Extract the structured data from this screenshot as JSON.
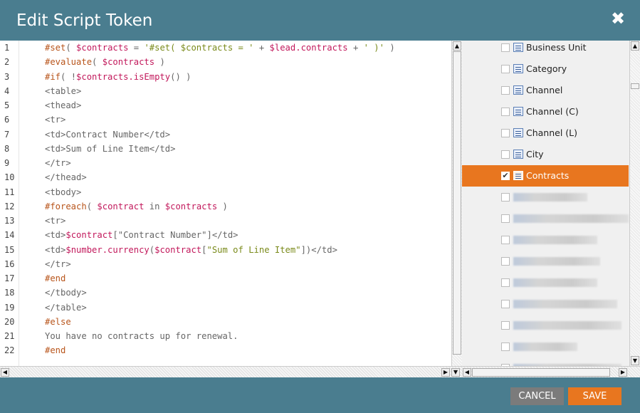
{
  "dialog": {
    "title": "Edit Script Token"
  },
  "editor": {
    "line_numbers": [
      "1",
      "2",
      "3",
      "4",
      "5",
      "6",
      "7",
      "8",
      "9",
      "10",
      "11",
      "12",
      "13",
      "14",
      "15",
      "16",
      "17",
      "18",
      "19",
      "20",
      "21",
      "22"
    ],
    "lines": [
      [
        {
          "t": "#set",
          "c": "dir"
        },
        {
          "t": "( ",
          "c": "plain"
        },
        {
          "t": "$contracts",
          "c": "var"
        },
        {
          "t": " = ",
          "c": "plain"
        },
        {
          "t": "'#set( $contracts = '",
          "c": "str"
        },
        {
          "t": " + ",
          "c": "plain"
        },
        {
          "t": "$lead.contracts",
          "c": "var"
        },
        {
          "t": " + ",
          "c": "plain"
        },
        {
          "t": "' )'",
          "c": "str"
        },
        {
          "t": " )",
          "c": "plain"
        }
      ],
      [
        {
          "t": "#evaluate",
          "c": "dir"
        },
        {
          "t": "( ",
          "c": "plain"
        },
        {
          "t": "$contracts",
          "c": "var"
        },
        {
          "t": " )",
          "c": "plain"
        }
      ],
      [
        {
          "t": "#if",
          "c": "dir"
        },
        {
          "t": "( !",
          "c": "plain"
        },
        {
          "t": "$contracts.isEmpty",
          "c": "var"
        },
        {
          "t": "() )",
          "c": "plain"
        }
      ],
      [
        {
          "t": "<table>",
          "c": "plain"
        }
      ],
      [
        {
          "t": "<thead>",
          "c": "plain"
        }
      ],
      [
        {
          "t": "<tr>",
          "c": "plain"
        }
      ],
      [
        {
          "t": "<td>Contract Number</td>",
          "c": "plain"
        }
      ],
      [
        {
          "t": "<td>Sum of Line Item</td>",
          "c": "plain"
        }
      ],
      [
        {
          "t": "</tr>",
          "c": "plain"
        }
      ],
      [
        {
          "t": "</thead>",
          "c": "plain"
        }
      ],
      [
        {
          "t": "<tbody>",
          "c": "plain"
        }
      ],
      [
        {
          "t": "#foreach",
          "c": "dir"
        },
        {
          "t": "( ",
          "c": "plain"
        },
        {
          "t": "$contract",
          "c": "var"
        },
        {
          "t": " in ",
          "c": "plain"
        },
        {
          "t": "$contracts",
          "c": "var"
        },
        {
          "t": " )",
          "c": "plain"
        }
      ],
      [
        {
          "t": "<tr>",
          "c": "plain"
        }
      ],
      [
        {
          "t": "<td>",
          "c": "plain"
        },
        {
          "t": "$contract",
          "c": "var"
        },
        {
          "t": "[\"Contract Number\"]</td>",
          "c": "plain"
        }
      ],
      [
        {
          "t": "<td>",
          "c": "plain"
        },
        {
          "t": "$number.currency",
          "c": "var"
        },
        {
          "t": "(",
          "c": "plain"
        },
        {
          "t": "$contract",
          "c": "var"
        },
        {
          "t": "[",
          "c": "plain"
        },
        {
          "t": "\"Sum of Line Item\"",
          "c": "str"
        },
        {
          "t": "])</td>",
          "c": "plain"
        }
      ],
      [
        {
          "t": "</tr>",
          "c": "plain"
        }
      ],
      [
        {
          "t": "#end",
          "c": "dir"
        }
      ],
      [
        {
          "t": "</tbody>",
          "c": "plain"
        }
      ],
      [
        {
          "t": "</table>",
          "c": "plain"
        }
      ],
      [
        {
          "t": "#else",
          "c": "dir"
        }
      ],
      [
        {
          "t": "You have no contracts up for renewal.",
          "c": "plain"
        }
      ],
      [
        {
          "t": "#end",
          "c": "dir"
        }
      ]
    ]
  },
  "field_list": {
    "items": [
      {
        "label": "Business Unit",
        "checked": false
      },
      {
        "label": "Category",
        "checked": false
      },
      {
        "label": "Channel",
        "checked": false
      },
      {
        "label": "Channel (C)",
        "checked": false
      },
      {
        "label": "Channel (L)",
        "checked": false
      },
      {
        "label": "City",
        "checked": false
      },
      {
        "label": "Contracts",
        "checked": true
      }
    ],
    "obscured_item_count": 9
  },
  "footer": {
    "cancel_label": "CANCEL",
    "save_label": "SAVE"
  },
  "colors": {
    "header_bg": "#4a7d8f",
    "accent": "#e8761f",
    "directive": "#b8541a",
    "variable": "#c2185b",
    "string": "#7a8a1a"
  }
}
